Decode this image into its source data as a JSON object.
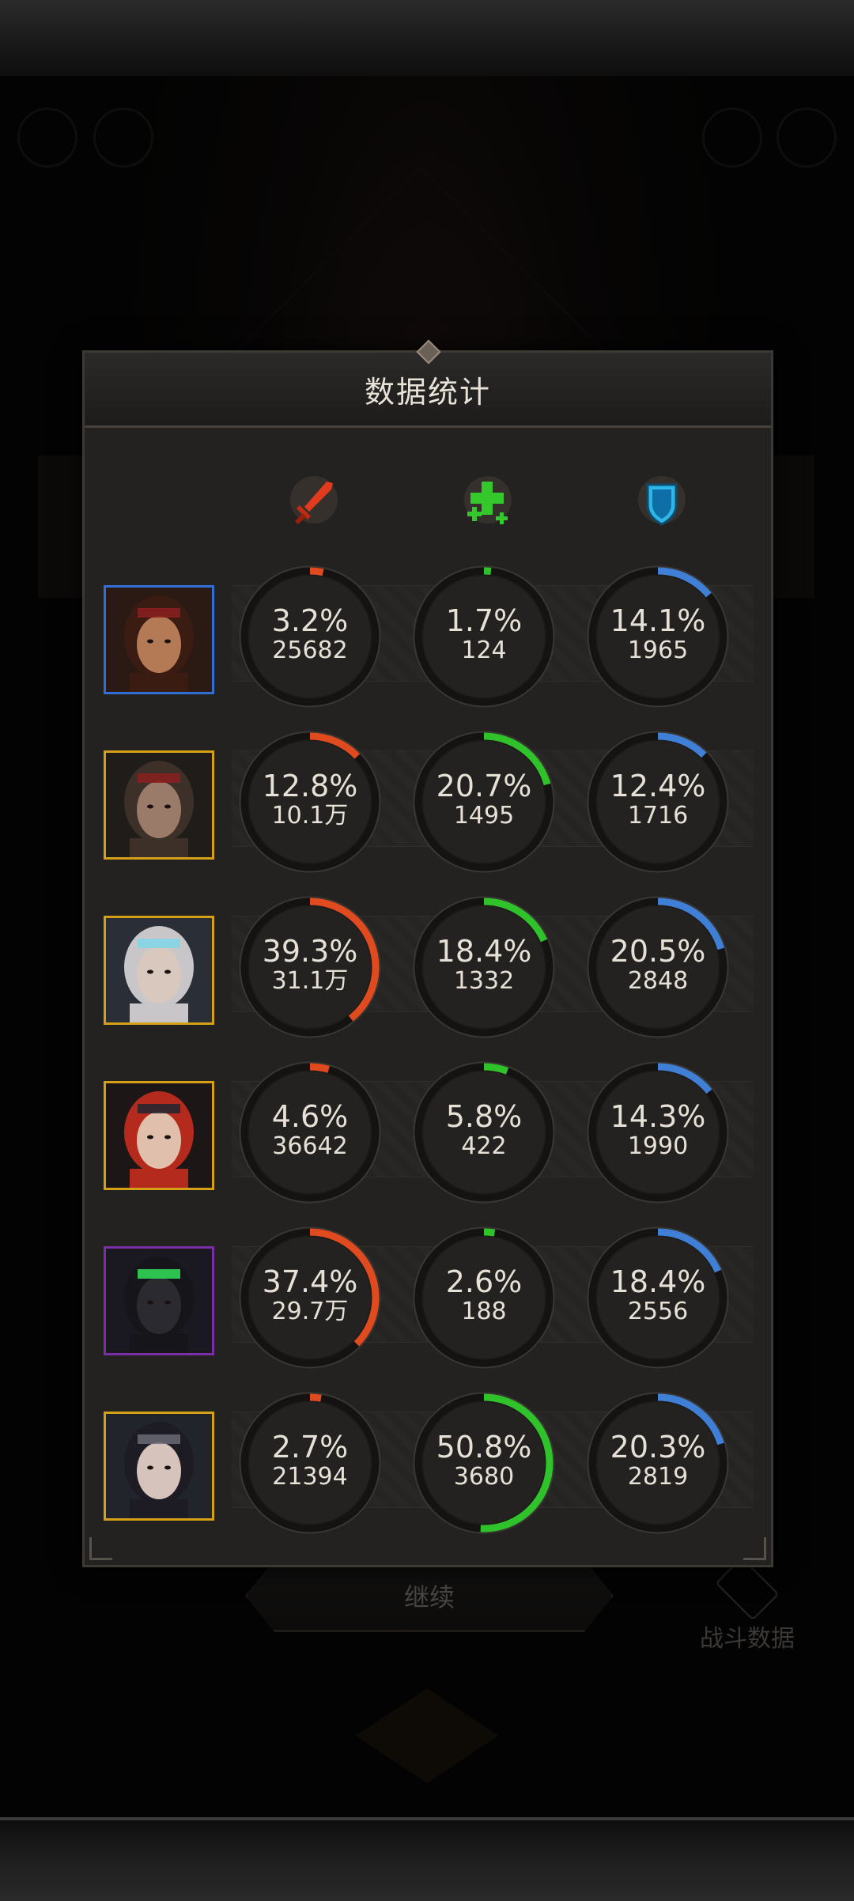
{
  "panel": {
    "title": "数据统计"
  },
  "columns": [
    {
      "icon": "damage-sword-icon",
      "color": "#e04a1f"
    },
    {
      "icon": "healing-cross-icon",
      "color": "#32c32a"
    },
    {
      "icon": "shield-icon",
      "color": "#2fb6e8"
    }
  ],
  "colors": {
    "damage": "#e04a1f",
    "heal": "#2fc22a",
    "shield": "#3f7fd6",
    "ring_track": "#141312",
    "ring_border": "#3a3733",
    "frame_gold": "#d4a017",
    "frame_blue": "#2f6fd6",
    "frame_purple": "#7b2fa6"
  },
  "heroes": [
    {
      "portrait": "hero-bandana-man-portrait",
      "frame": "blue",
      "damage": {
        "pct_label": "3.2%",
        "pct": 3.2,
        "value": "25682"
      },
      "heal": {
        "pct_label": "1.7%",
        "pct": 1.7,
        "value": "124"
      },
      "shield": {
        "pct_label": "14.1%",
        "pct": 14.1,
        "value": "1965"
      }
    },
    {
      "portrait": "hero-hooded-woman-portrait",
      "frame": "gold",
      "damage": {
        "pct_label": "12.8%",
        "pct": 12.8,
        "value": "10.1万"
      },
      "heal": {
        "pct_label": "20.7%",
        "pct": 20.7,
        "value": "1495"
      },
      "shield": {
        "pct_label": "12.4%",
        "pct": 12.4,
        "value": "1716"
      }
    },
    {
      "portrait": "hero-silver-hair-woman-portrait",
      "frame": "gold",
      "damage": {
        "pct_label": "39.3%",
        "pct": 39.3,
        "value": "31.1万"
      },
      "heal": {
        "pct_label": "18.4%",
        "pct": 18.4,
        "value": "1332"
      },
      "shield": {
        "pct_label": "20.5%",
        "pct": 20.5,
        "value": "2848"
      }
    },
    {
      "portrait": "hero-red-hair-woman-portrait",
      "frame": "gold",
      "damage": {
        "pct_label": "4.6%",
        "pct": 4.6,
        "value": "36642"
      },
      "heal": {
        "pct_label": "5.8%",
        "pct": 5.8,
        "value": "422"
      },
      "shield": {
        "pct_label": "14.3%",
        "pct": 14.3,
        "value": "1990"
      }
    },
    {
      "portrait": "hero-raven-portrait",
      "frame": "purple",
      "damage": {
        "pct_label": "37.4%",
        "pct": 37.4,
        "value": "29.7万"
      },
      "heal": {
        "pct_label": "2.6%",
        "pct": 2.6,
        "value": "188"
      },
      "shield": {
        "pct_label": "18.4%",
        "pct": 18.4,
        "value": "2556"
      }
    },
    {
      "portrait": "hero-dark-hair-woman-portrait",
      "frame": "gold",
      "damage": {
        "pct_label": "2.7%",
        "pct": 2.7,
        "value": "21394"
      },
      "heal": {
        "pct_label": "50.8%",
        "pct": 50.8,
        "value": "3680"
      },
      "shield": {
        "pct_label": "20.3%",
        "pct": 20.3,
        "value": "2819"
      }
    }
  ],
  "continue_button": {
    "label": "继续"
  },
  "battle_data_button": {
    "label": "战斗数据"
  }
}
